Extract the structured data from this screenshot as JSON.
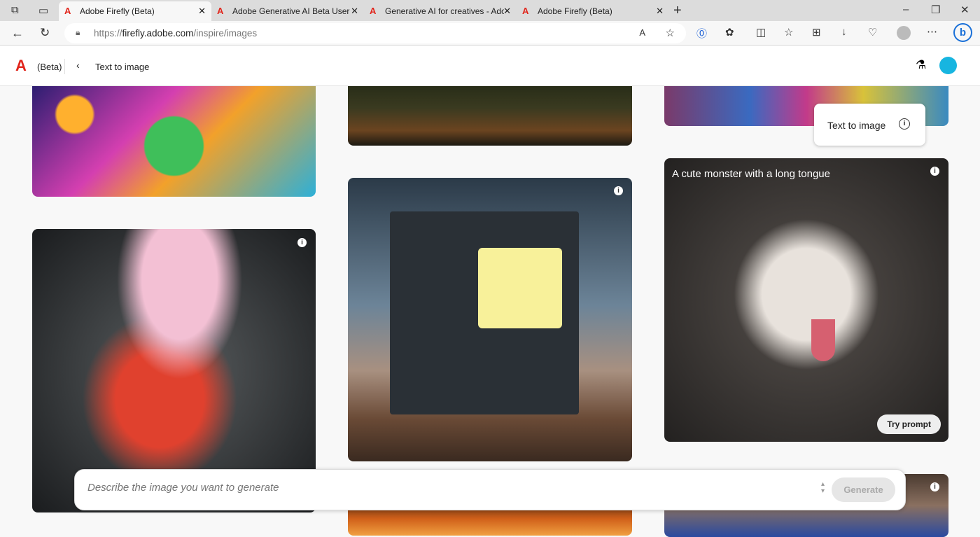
{
  "browser": {
    "tabs": [
      {
        "title": "Adobe Firefly (Beta)"
      },
      {
        "title": "Adobe Generative AI Beta User Guide"
      },
      {
        "title": "Generative AI for creatives - Adobe"
      },
      {
        "title": "Adobe Firefly (Beta)"
      }
    ],
    "url_prefix": "https://",
    "url_host": "firefly.adobe.com",
    "url_path": "/inspire/images"
  },
  "app": {
    "beta_label": "(Beta)",
    "page_title": "Text to image"
  },
  "tooltip": {
    "label": "Text to image"
  },
  "cards": [
    {
      "title": "A cute monster with a long tongue",
      "action": "Try prompt"
    }
  ],
  "prompt": {
    "placeholder": "Describe the image you want to generate",
    "generate_label": "Generate"
  }
}
